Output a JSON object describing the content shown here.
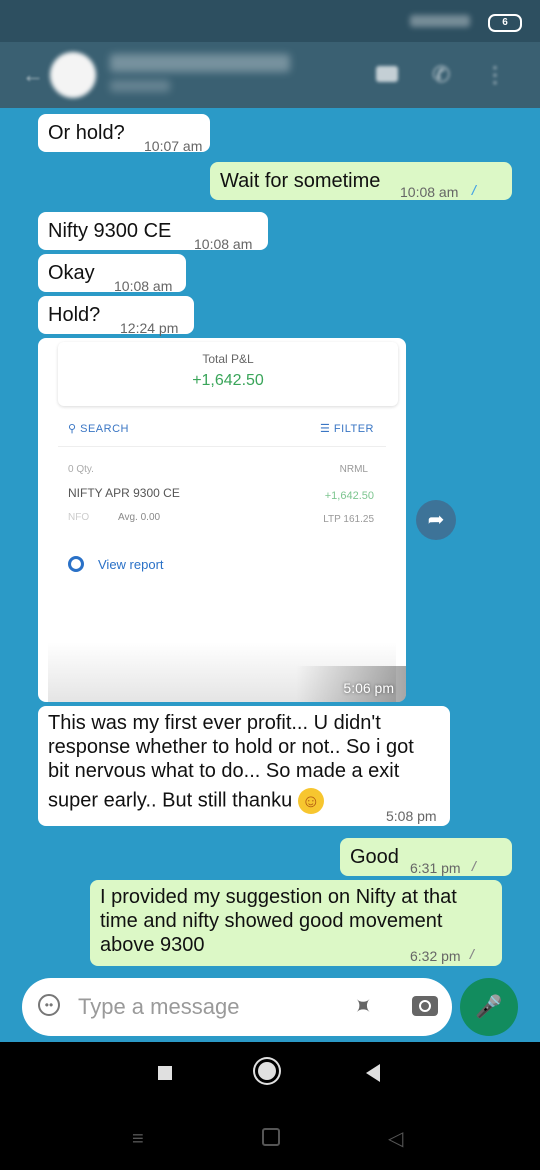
{
  "status_bar": {
    "battery": "6"
  },
  "composer": {
    "placeholder": "Type a message"
  },
  "messages": [
    {
      "dir": "in",
      "text": "Or hold?",
      "time": "10:07 am"
    },
    {
      "dir": "out",
      "text": "Wait for sometime",
      "time": "10:08 am",
      "ticks": "read"
    },
    {
      "dir": "in",
      "text": "Nifty 9300 CE",
      "time": "10:08 am"
    },
    {
      "dir": "in",
      "text": "Okay",
      "time": "10:08 am"
    },
    {
      "dir": "in",
      "text": "Hold?",
      "time": "12:24 pm"
    },
    {
      "dir": "in",
      "type": "image",
      "time": "5:06 pm"
    },
    {
      "dir": "in",
      "text_lines": [
        "This was my first ever profit... U didn't",
        "response whether to hold or not.. So i got",
        "bit nervous what to do...  So made a exit",
        "super early.. But still thanku"
      ],
      "emoji": "☺",
      "time": "5:08 pm"
    },
    {
      "dir": "out",
      "text": "Good",
      "time": "6:31 pm",
      "ticks": "delivered"
    },
    {
      "dir": "out",
      "text_lines": [
        "I provided my suggestion on Nifty at that",
        "time and nifty showed good movement",
        "above 9300"
      ],
      "time": "6:32 pm",
      "ticks": "delivered"
    }
  ],
  "screenshot": {
    "total_label": "Total P&L",
    "total_value": "+1,642.50",
    "search_label": "SEARCH",
    "filter_label": "FILTER",
    "qty": "0 Qty.",
    "product": "NRML",
    "instrument": "NIFTY APR 9300 CE",
    "pnl": "+1,642.50",
    "exchange": "NFO",
    "avg": "Avg. 0.00",
    "ltp": "LTP 161.25",
    "view_report": "View report"
  },
  "colors": {
    "chat_bg": "#2b9ac7",
    "incoming_bubble": "#ffffff",
    "outgoing_bubble": "#dcf8c6",
    "read_tick": "#4aa5e4",
    "mic_button": "#128c5e"
  },
  "icons": [
    "back-icon",
    "video-call-icon",
    "voice-call-icon",
    "more-icon",
    "forward-icon",
    "emoji-icon",
    "attach-icon",
    "camera-icon",
    "mic-icon",
    "nav-square-icon",
    "nav-home-icon",
    "nav-back-icon"
  ]
}
